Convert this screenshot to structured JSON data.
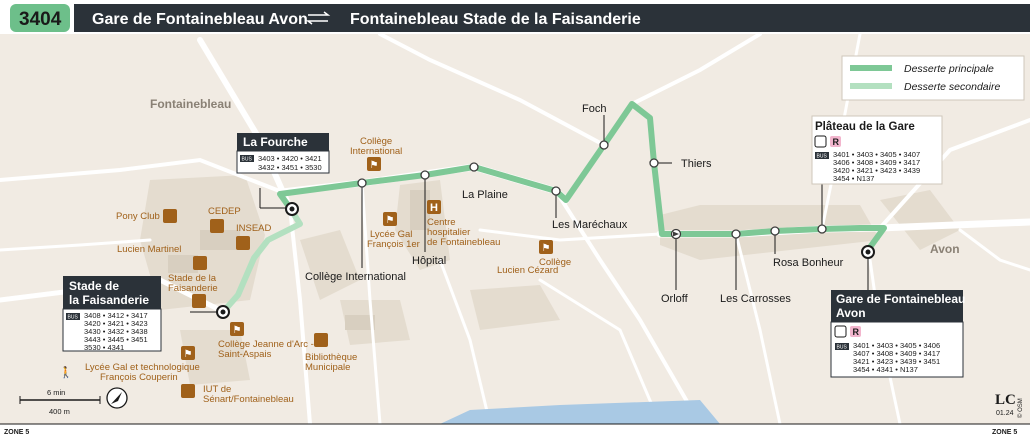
{
  "header": {
    "line_number": "3404",
    "origin": "Gare de Fontainebleau Avon",
    "destination": "Fontainebleau Stade de la Faisanderie"
  },
  "colors": {
    "route_main": "#7ec896",
    "route_secondary": "#b3e0c0",
    "header_bg": "#2b3239",
    "badge_bg": "#6dbf8a",
    "poi": "#a0611a",
    "map_bg": "#f1ebe3"
  },
  "legend": {
    "main": "Desserte principale",
    "secondary": "Desserte secondaire"
  },
  "towns": {
    "fontainebleau": "Fontainebleau",
    "avon": "Avon"
  },
  "stops": {
    "la_fourche": "La Fourche",
    "college_international": "Collège International",
    "hopital": "Hôpital",
    "la_plaine": "La Plaine",
    "les_marechaux": "Les Maréchaux",
    "foch": "Foch",
    "thiers": "Thiers",
    "orloff": "Orloff",
    "les_carrosses": "Les Carrosses",
    "rosa_bonheur": "Rosa Bonheur",
    "plateau_de_la_gare": "Plâteau de la Gare",
    "gare_line1": "Gare de Fontainebleau",
    "gare_line2": "Avon",
    "stade_line1": "Stade de",
    "stade_line2": "la Faisanderie"
  },
  "connections": {
    "bus_label": "BUS",
    "rail_label": "R",
    "la_fourche": [
      "3403 • 3420 • 3421",
      "3432 • 3451 • 3530"
    ],
    "stade": [
      "3408 • 3412 • 3417",
      "3420 • 3421 • 3423",
      "3430 • 3432 • 3438",
      "3443 • 3445 • 3451",
      "3530 • 4341"
    ],
    "plateau": [
      "3401 • 3403 • 3405 • 3407",
      "3406 • 3408 • 3409 • 3417",
      "3420 • 3421 • 3423 • 3439",
      "3454 • N137"
    ],
    "gare": [
      "3401 • 3403 • 3405 • 3406",
      "3407 • 3408 • 3409 • 3417",
      "3421 • 3423 • 3439 • 3451",
      "3454 • 4341 • N137"
    ]
  },
  "pois": {
    "college_international": [
      "Collège",
      "International"
    ],
    "lycee_francois_1er": [
      "Lycée Gal",
      "François 1er"
    ],
    "centre_hospitalier": [
      "Centre",
      "hospitalier",
      "de Fontainebleau"
    ],
    "college_lucien_cezard": [
      "Collège",
      "Lucien Cézard"
    ],
    "pony_club": "Pony Club",
    "cedep": "CEDEP",
    "insead": "INSEAD",
    "lucien_martinel": "Lucien Martinel",
    "stade_faisanderie": [
      "Stade de la",
      "Faisanderie"
    ],
    "college_jeanne_arc": [
      "Collège Jeanne d'Arc -",
      "Saint-Aspais"
    ],
    "bibliotheque": [
      "Bibliothèque",
      "Municipale"
    ],
    "lycee_couperin": [
      "Lycée Gal et technologique",
      "François Couperin"
    ],
    "iut": [
      "IUT de",
      "Sénart/Fontainebleau"
    ]
  },
  "scale": {
    "walk": "6 min",
    "distance": "400 m"
  },
  "footer": {
    "zone_left": "ZONE 5",
    "zone_right": "ZONE 5",
    "copyright": "© OSM",
    "date": "01.24"
  }
}
